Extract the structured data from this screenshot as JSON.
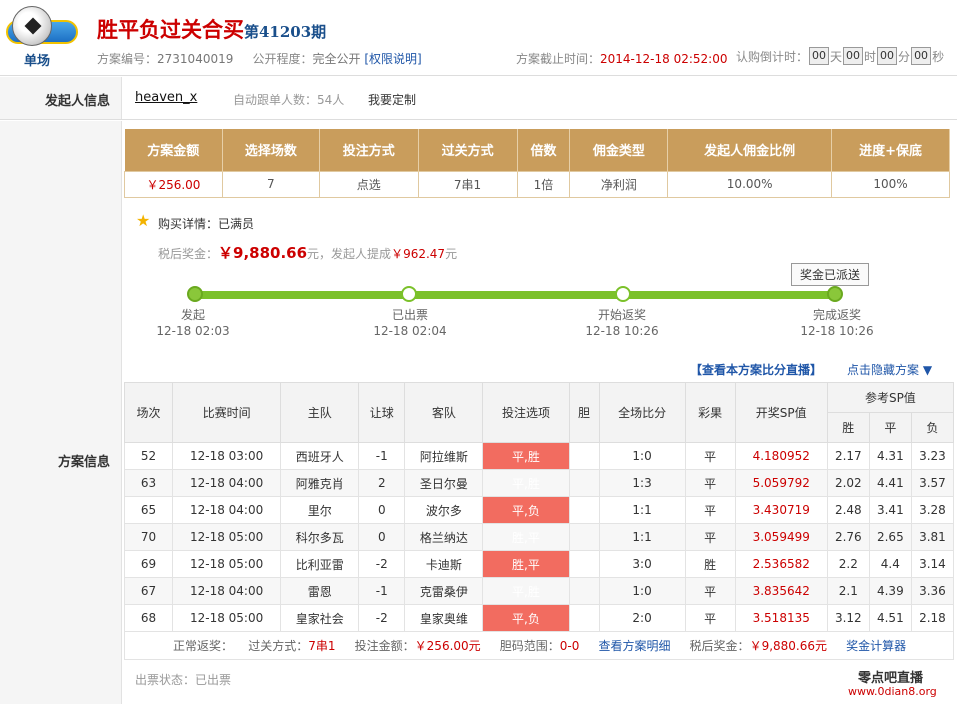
{
  "header": {
    "logo_text": "单场",
    "title": "胜平负过关合买",
    "issue": "第41203期",
    "plan_no_label": "方案编号：",
    "plan_no": "2731040019",
    "public_label": "公开程度：",
    "public_value": "完全公开",
    "permission_link": "[权限说明]",
    "deadline_label": "方案截止时间：",
    "deadline_value": "2014-12-18 02:52:00",
    "countdown_label": "认购倒计时：",
    "countdown": [
      {
        "value": "00",
        "unit": "天"
      },
      {
        "value": "00",
        "unit": "时"
      },
      {
        "value": "00",
        "unit": "分"
      },
      {
        "value": "00",
        "unit": "秒"
      }
    ]
  },
  "sponsor": {
    "label": "发起人信息",
    "name": "heaven_x",
    "follow_label": "自动跟单人数：",
    "follow_count": "54人",
    "custom": "我要定制"
  },
  "summary": {
    "headers": [
      "方案金额",
      "选择场数",
      "投注方式",
      "过关方式",
      "倍数",
      "佣金类型",
      "发起人佣金比例",
      "进度+保底"
    ],
    "values": [
      "￥256.00",
      "7",
      "点选",
      "7串1",
      "1倍",
      "净利润",
      "10.00%",
      "100%"
    ]
  },
  "buy": {
    "label": "购买详情：",
    "status": "已满员",
    "prize_label": "税后奖金：",
    "prize_value": "￥9,880.66",
    "prize_unit": "元，发起人提成",
    "commission": "￥962.47",
    "commission_unit": "元"
  },
  "distributed_badge": "奖金已派送",
  "progress": {
    "steps": [
      {
        "name": "发起",
        "time": "12-18 02:03",
        "filled": true
      },
      {
        "name": "已出票",
        "time": "12-18 02:04",
        "filled": false
      },
      {
        "name": "开始返奖",
        "time": "12-18 10:26",
        "filled": false
      },
      {
        "name": "完成返奖",
        "time": "12-18 10:26",
        "filled": true
      }
    ]
  },
  "links": {
    "live": "【查看本方案比分直播】",
    "hide": "点击隐藏方案 ▼"
  },
  "plan_label": "方案信息",
  "detail": {
    "headers": [
      "场次",
      "比赛时间",
      "主队",
      "让球",
      "客队",
      "投注选项",
      "胆",
      "全场比分",
      "彩果",
      "开奖SP值"
    ],
    "sp_group": "参考SP值",
    "sp_sub": [
      "胜",
      "平",
      "负"
    ],
    "rows": [
      {
        "no": "52",
        "time": "12-18 03:00",
        "home": "西班牙人",
        "handicap": "-1",
        "away": "阿拉维斯",
        "pick": "平,胜",
        "dan": "",
        "score": "1:0",
        "result": "平",
        "sp": "4.180952",
        "w": "2.17",
        "d": "4.31",
        "l": "3.23"
      },
      {
        "no": "63",
        "time": "12-18 04:00",
        "home": "阿雅克肖",
        "handicap": "2",
        "away": "圣日尔曼",
        "pick": "平,胜",
        "dan": "",
        "score": "1:3",
        "result": "平",
        "sp": "5.059792",
        "w": "2.02",
        "d": "4.41",
        "l": "3.57"
      },
      {
        "no": "65",
        "time": "12-18 04:00",
        "home": "里尔",
        "handicap": "0",
        "away": "波尔多",
        "pick": "平,负",
        "dan": "",
        "score": "1:1",
        "result": "平",
        "sp": "3.430719",
        "w": "2.48",
        "d": "3.41",
        "l": "3.28"
      },
      {
        "no": "70",
        "time": "12-18 05:00",
        "home": "科尔多瓦",
        "handicap": "0",
        "away": "格兰纳达",
        "pick": "胜,平",
        "dan": "",
        "score": "1:1",
        "result": "平",
        "sp": "3.059499",
        "w": "2.76",
        "d": "2.65",
        "l": "3.81"
      },
      {
        "no": "69",
        "time": "12-18 05:00",
        "home": "比利亚雷",
        "handicap": "-2",
        "away": "卡迪斯",
        "pick": "胜,平",
        "dan": "",
        "score": "3:0",
        "result": "胜",
        "sp": "2.536582",
        "w": "2.2",
        "d": "4.4",
        "l": "3.14"
      },
      {
        "no": "67",
        "time": "12-18 04:00",
        "home": "雷恩",
        "handicap": "-1",
        "away": "克雷桑伊",
        "pick": "平,胜",
        "dan": "",
        "score": "1:0",
        "result": "平",
        "sp": "3.835642",
        "w": "2.1",
        "d": "4.39",
        "l": "3.36"
      },
      {
        "no": "68",
        "time": "12-18 05:00",
        "home": "皇家社会",
        "handicap": "-2",
        "away": "皇家奥维",
        "pick": "平,负",
        "dan": "",
        "score": "2:0",
        "result": "平",
        "sp": "3.518135",
        "w": "3.12",
        "d": "4.51",
        "l": "2.18"
      }
    ],
    "footer": {
      "normal": "正常返奖：",
      "pass_label": "过关方式：",
      "pass_value": "7串1",
      "amount_label": "投注金额：",
      "amount_value": "￥256.00元",
      "range_label": "胆码范围：",
      "range_value": "0-0",
      "view_detail": "查看方案明细",
      "prize_label": "税后奖金：",
      "prize_value": "￥9,880.66元",
      "calculator": "奖金计算器"
    }
  },
  "ticket_status": {
    "label": "出票状态：",
    "value": "已出票"
  },
  "watermark": {
    "brand": "零点吧直播",
    "url": "www.0dian8.org"
  }
}
